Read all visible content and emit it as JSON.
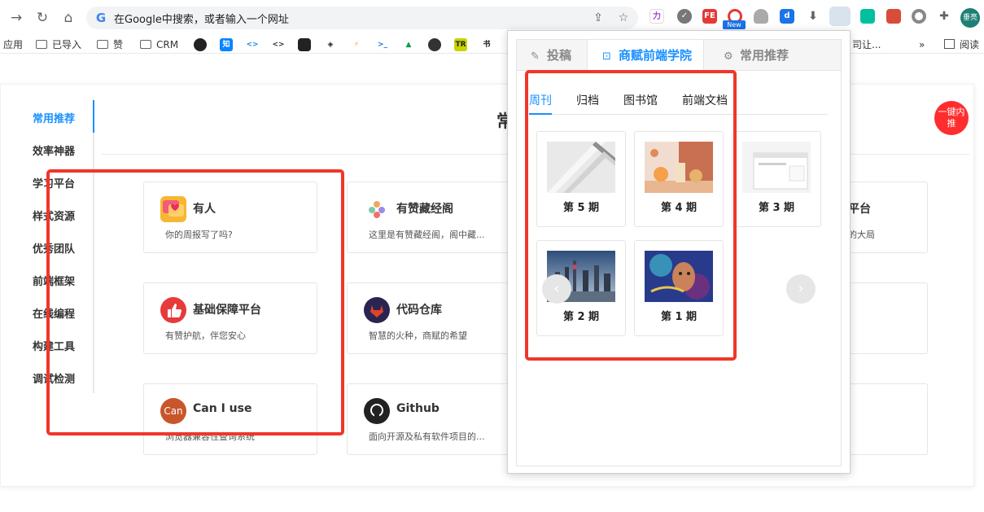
{
  "browser": {
    "omnibox_text": "在Google中搜索，或者输入一个网址",
    "new_badge": "New",
    "profile_text": "垂亮"
  },
  "bookmarks": {
    "apps": "应用",
    "folders": [
      "已导入",
      "赞",
      "CRM"
    ],
    "icon_zhi": "知",
    "trailing_text": "司让...",
    "more": "»",
    "reading_list": "阅读"
  },
  "sidebar": {
    "items": [
      {
        "label": "常用推荐",
        "active": true
      },
      {
        "label": "效率神器"
      },
      {
        "label": "学习平台"
      },
      {
        "label": "样式资源"
      },
      {
        "label": "优秀团队"
      },
      {
        "label": "前端框架"
      },
      {
        "label": "在线编程"
      },
      {
        "label": "构建工具"
      },
      {
        "label": "调试检测"
      }
    ]
  },
  "main": {
    "title_fragment": "常",
    "push_button": "一键内推",
    "cards": [
      {
        "title": "有人",
        "desc": "你的周报写了吗?",
        "icon": "chat-bubble-heart-icon"
      },
      {
        "title": "有赞藏经阁",
        "desc": "这里是有赞藏经阁，阁中藏...",
        "icon": "youzan-library-icon"
      },
      {
        "title": "基础保障平台",
        "desc": "有赞护航，伴您安心",
        "icon": "thumbs-up-icon"
      },
      {
        "title": "代码仓库",
        "desc": "智慧的火种，商赋的希望",
        "icon": "gitlab-icon"
      },
      {
        "title": "Can I use",
        "desc": "浏览器兼容性查询系统",
        "icon": "caniuse-icon",
        "icon_text": "Can"
      },
      {
        "title": "Github",
        "desc": "面向开源及私有软件项目的...",
        "icon": "github-icon"
      }
    ],
    "right_fragments": [
      {
        "title": "平台",
        "desc": "的大局"
      },
      {
        "title": "",
        "desc": ""
      },
      {
        "title": "",
        "desc": ""
      }
    ]
  },
  "popup": {
    "tabs": [
      {
        "label": "投稿",
        "icon": "pencil-icon"
      },
      {
        "label": "商赋前端学院",
        "icon": "box-icon",
        "active": true
      },
      {
        "label": "常用推荐",
        "icon": "gear-icon"
      }
    ],
    "subtabs": [
      {
        "label": "周刊",
        "active": true
      },
      {
        "label": "归档"
      },
      {
        "label": "图书馆"
      },
      {
        "label": "前端文档"
      }
    ],
    "issues": [
      {
        "label": "第 5 期"
      },
      {
        "label": "第 4 期"
      },
      {
        "label": "第 3 期"
      },
      {
        "label": "第 2 期"
      },
      {
        "label": "第 1 期"
      }
    ]
  },
  "colors": {
    "accent": "#1890ff",
    "highlight_box": "#f0362b",
    "push_button": "#ff2d2d"
  }
}
